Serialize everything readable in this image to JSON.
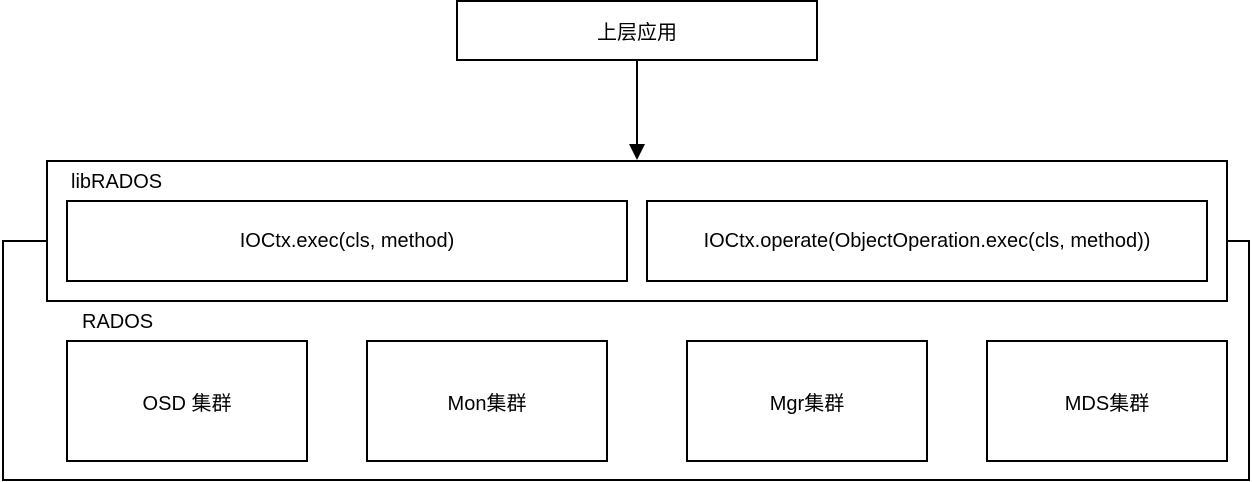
{
  "top_box": {
    "label": "上层应用"
  },
  "librados": {
    "label": "libRADOS",
    "boxes": [
      {
        "label": "IOCtx.exec(cls, method)"
      },
      {
        "label": "IOCtx.operate(ObjectOperation.exec(cls, method))"
      }
    ]
  },
  "rados": {
    "label": "RADOS",
    "clusters": [
      {
        "label": "OSD 集群"
      },
      {
        "label": "Mon集群"
      },
      {
        "label": "Mgr集群"
      },
      {
        "label": "MDS集群"
      }
    ]
  }
}
